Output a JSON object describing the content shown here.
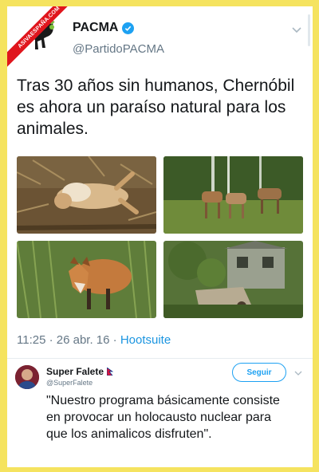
{
  "watermark": "ASIVAESPAÑA.COM",
  "tweet": {
    "name": "PACMA",
    "handle": "@PartidoPACMA",
    "text": "Tras 30 años sin humanos, Chernóbil es ahora un paraíso natural para los animales.",
    "time": "11:25 · 26 abr. 16 · ",
    "source": "Hootsuite"
  },
  "reply": {
    "name": "Super Falete",
    "handle": "@SuperFalete",
    "follow_label": "Seguir",
    "text": "\"Nuestro programa básicamente consiste en provocar un holocausto nuclear para que los animalicos disfruten\"."
  },
  "icons": {
    "verified": "verified-badge-icon",
    "more": "chevron-down-icon",
    "flag": "nepal-flag-icon"
  },
  "colors": {
    "background": "#f5e35f",
    "accent": "#1da1f2",
    "ribbon": "#e0161d"
  }
}
